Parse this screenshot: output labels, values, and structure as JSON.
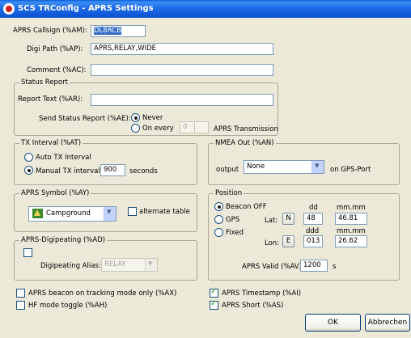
{
  "window": {
    "title": "SCS TRConfig - APRS Settings"
  },
  "callsign": {
    "label": "APRS Callsign (%AM):",
    "value": "DL8RCB"
  },
  "digipath": {
    "label": "Digi Path (%AP):",
    "value": "APRS,RELAY,WIDE"
  },
  "comment": {
    "label": "Comment (%AC):",
    "value": ""
  },
  "status_report": {
    "title": "Status Report",
    "report_label": "Report Text (%AR):",
    "report_value": "",
    "send_label": "Send Status Report (%AE):",
    "never_label": "Never",
    "on_every_label": "On every",
    "interval_value": "0",
    "transmission_label": "APRS Transmission"
  },
  "tx_interval": {
    "title": "TX Interval (%AT)",
    "auto_label": "Auto TX Interval",
    "manual_label": "Manual TX interval:",
    "value": "900",
    "unit": "seconds"
  },
  "nmea": {
    "title": "NMEA Out (%AN)",
    "output_label": "output",
    "selected": "None",
    "suffix": "on GPS-Port"
  },
  "symbol": {
    "title": "APRS Symbol (%AY)",
    "selected": "Campground",
    "icon": "campground-icon",
    "alternate_label": "alternate table"
  },
  "digipeating": {
    "title": "APRS-Digipeating (%AD)",
    "alias_label": "Digipeating Alias:",
    "alias_value": "RELAY"
  },
  "position": {
    "title": "Position",
    "beacon_off_label": "Beacon OFF",
    "gps_label": "GPS",
    "fixed_label": "Fixed",
    "dd_header": "dd",
    "mm_header": "mm.mm",
    "ddd_header": "ddd",
    "mm_header2": "mm.mm",
    "lat_label": "Lat:",
    "lat_dir": "N",
    "lat_deg": "48",
    "lat_min": "46.81",
    "lon_label": "Lon:",
    "lon_dir": "E",
    "lon_deg": "013",
    "lon_min": "26.62",
    "valid_label": "APRS Valid (%AV)",
    "valid_value": "1200",
    "valid_unit": "s"
  },
  "options": {
    "tracking_label": "APRS beacon on tracking mode only (%AX)",
    "hf_label": "HF mode toggle (%AH)",
    "timestamp_label": "APRS Timestamp (%AI)",
    "short_label": "APRS Short (%AS)"
  },
  "buttons": {
    "ok": "OK",
    "cancel": "Abbrechen"
  },
  "colors": {
    "titlebar": "#0a5fd8",
    "dialog_bg": "#ece9d8",
    "selection": "#316ac5"
  }
}
